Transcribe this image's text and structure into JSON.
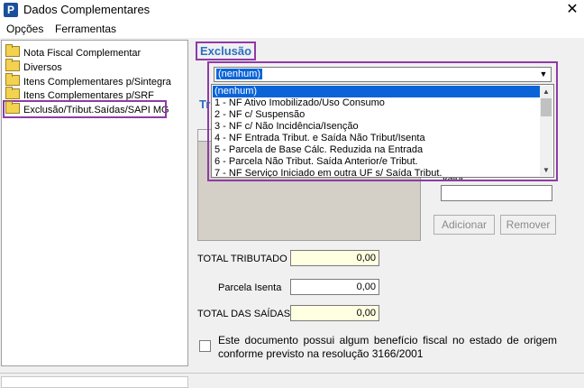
{
  "window": {
    "title": "Dados Complementares",
    "app_icon": "P",
    "close_glyph": "✕"
  },
  "menu": [
    "Opções",
    "Ferramentas"
  ],
  "tree": {
    "items": [
      "Nota Fiscal Complementar",
      "Diversos",
      "Itens Complementares p/Sintegra",
      "Itens Complementares p/SRF",
      "Exclusão/Tribut.Saídas/SAPI MG"
    ],
    "selected_index": 4
  },
  "panel": {
    "title": "Exclusão",
    "group_label_partial": "Tr",
    "combo": {
      "value": "(nenhum)"
    },
    "dropdown_options": [
      "(nenhum)",
      "1 - NF Ativo Imobilizado/Uso Consumo",
      "2 - NF c/ Suspensão",
      "3 - NF c/ Não Incidência/Isenção",
      "4 - NF Entrada Tribut. e Saída Não Tribut/Isenta",
      "5 - Parcela de Base Cálc. Reduzida na Entrada",
      "6 - Parcela Não Tribut. Saída Anterior/e Tribut.",
      "7 - NF Serviço Iniciado em outra UF s/ Saída Tribut."
    ],
    "valor_label": "Valor",
    "buttons": {
      "add": "Adicionar",
      "remove": "Remover"
    }
  },
  "totals": {
    "total_tributado": {
      "label": "TOTAL TRIBUTADO",
      "value": "0,00"
    },
    "parcela_isenta": {
      "label": "Parcela Isenta",
      "value": "0,00"
    },
    "total_saidas": {
      "label": "TOTAL DAS SAÍDAS",
      "value": "0,00"
    }
  },
  "checkbox": {
    "checked": false,
    "label": "Este documento possui algum benefício fiscal no estado de origem conforme previsto na resolução 3166/2001"
  },
  "colors": {
    "accent_blue": "#2e6fc0",
    "highlight": "#8f3aa7",
    "selection": "#0a64d8"
  }
}
